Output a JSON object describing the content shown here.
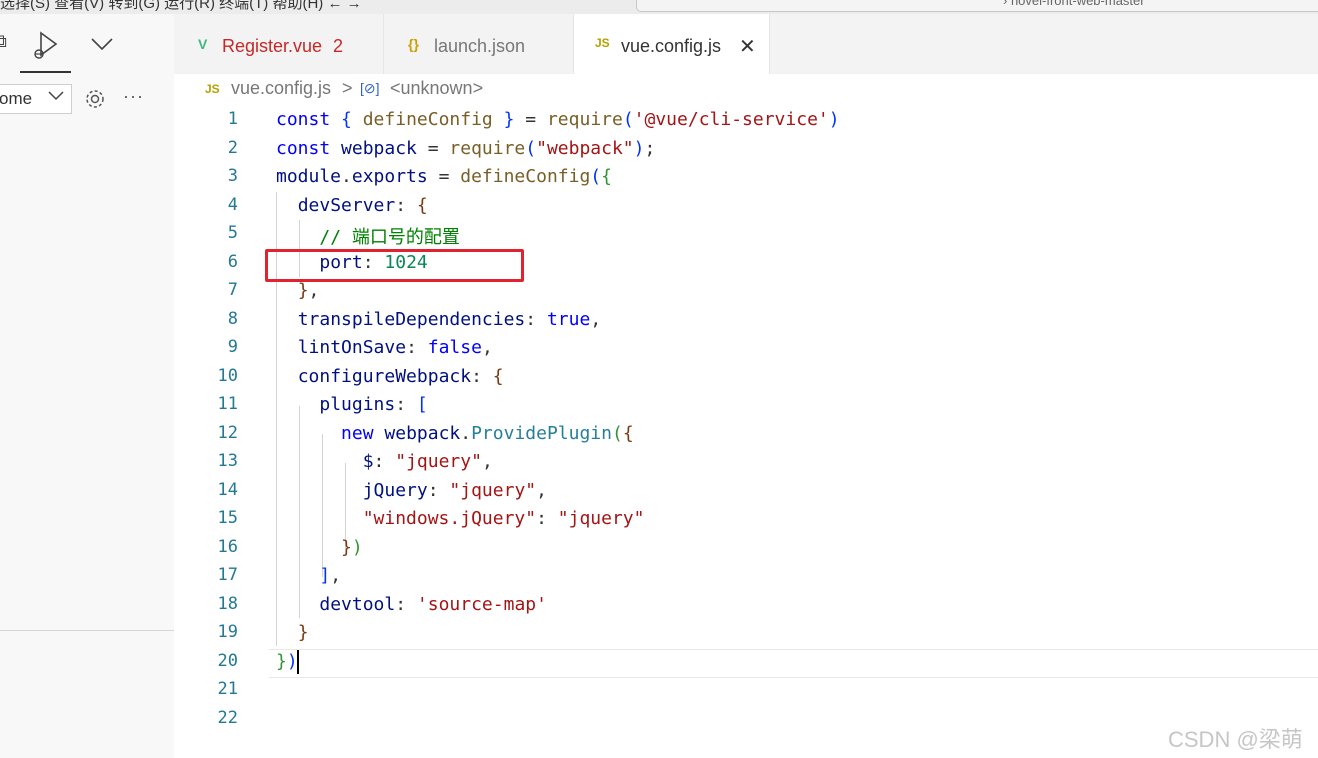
{
  "window": {
    "menu_text": "选择(S)  查看(V)  转到(G)  运行(R)  终端(T)  帮助(H)      ←  →",
    "search_text": "› novel-front-web-master"
  },
  "sidebar": {
    "select_value": "ome",
    "icons": [
      "split-icon",
      "run-debug-icon",
      "chevron-down-icon",
      "gear-icon",
      "more-icon"
    ]
  },
  "tabs": [
    {
      "label": "Register.vue",
      "badge": "2",
      "icon": "V",
      "color": "#c62828",
      "active": false
    },
    {
      "label": "launch.json",
      "icon": "{}",
      "color": "#777777",
      "active": false
    },
    {
      "label": "vue.config.js",
      "icon": "JS",
      "color": "#333333",
      "active": true
    }
  ],
  "breadcrumb": {
    "file_icon": "JS",
    "file": "vue.config.js",
    "separator": ">",
    "symbol_icon": "[⊘]",
    "symbol": "<unknown>"
  },
  "editor": {
    "line_numbers": [
      "1",
      "2",
      "3",
      "4",
      "5",
      "6",
      "7",
      "8",
      "9",
      "10",
      "11",
      "12",
      "13",
      "14",
      "15",
      "16",
      "17",
      "18",
      "19",
      "20",
      "21",
      "22"
    ],
    "lines": [
      [
        [
          "kw",
          "const "
        ],
        [
          "b1",
          "{ "
        ],
        [
          "fn",
          "defineConfig"
        ],
        [
          "b1",
          " }"
        ],
        [
          "pn",
          " = "
        ],
        [
          "fn",
          "require"
        ],
        [
          "b1",
          "("
        ],
        [
          "str",
          "'@vue/cli-service'"
        ],
        [
          "b1",
          ")"
        ]
      ],
      [
        [
          "kw",
          "const "
        ],
        [
          "var",
          "webpack"
        ],
        [
          "pn",
          " = "
        ],
        [
          "fn",
          "require"
        ],
        [
          "b1",
          "("
        ],
        [
          "str",
          "\"webpack\""
        ],
        [
          "b1",
          ")"
        ],
        [
          "pn",
          ";"
        ]
      ],
      [
        [
          "var",
          "module"
        ],
        [
          "pn",
          "."
        ],
        [
          "var",
          "exports"
        ],
        [
          "pn",
          " = "
        ],
        [
          "fn",
          "defineConfig"
        ],
        [
          "b1",
          "("
        ],
        [
          "b2",
          "{"
        ]
      ],
      [
        [
          "pn",
          "  "
        ],
        [
          "var",
          "devServer"
        ],
        [
          "pn",
          ": "
        ],
        [
          "b3",
          "{"
        ]
      ],
      [
        [
          "pn",
          "    "
        ],
        [
          "cm",
          "// 端口号的配置"
        ]
      ],
      [
        [
          "pn",
          "    "
        ],
        [
          "var",
          "port"
        ],
        [
          "pn",
          ": "
        ],
        [
          "num",
          "1024"
        ]
      ],
      [
        [
          "pn",
          "  "
        ],
        [
          "b3",
          "}"
        ],
        [
          "pn",
          ","
        ]
      ],
      [
        [
          "pn",
          "  "
        ],
        [
          "var",
          "transpileDependencies"
        ],
        [
          "pn",
          ": "
        ],
        [
          "kw",
          "true"
        ],
        [
          "pn",
          ","
        ]
      ],
      [
        [
          "pn",
          "  "
        ],
        [
          "var",
          "lintOnSave"
        ],
        [
          "pn",
          ": "
        ],
        [
          "kw",
          "false"
        ],
        [
          "pn",
          ","
        ]
      ],
      [
        [
          "pn",
          "  "
        ],
        [
          "var",
          "configureWebpack"
        ],
        [
          "pn",
          ": "
        ],
        [
          "b3",
          "{"
        ]
      ],
      [
        [
          "pn",
          "    "
        ],
        [
          "var",
          "plugins"
        ],
        [
          "pn",
          ": "
        ],
        [
          "b1",
          "["
        ]
      ],
      [
        [
          "pn",
          "      "
        ],
        [
          "kw",
          "new "
        ],
        [
          "var",
          "webpack"
        ],
        [
          "pn",
          "."
        ],
        [
          "cls",
          "ProvidePlugin"
        ],
        [
          "b2",
          "("
        ],
        [
          "b3",
          "{"
        ]
      ],
      [
        [
          "pn",
          "        "
        ],
        [
          "var",
          "$"
        ],
        [
          "pn",
          ": "
        ],
        [
          "str",
          "\"jquery\""
        ],
        [
          "pn",
          ","
        ]
      ],
      [
        [
          "pn",
          "        "
        ],
        [
          "var",
          "jQuery"
        ],
        [
          "pn",
          ": "
        ],
        [
          "str",
          "\"jquery\""
        ],
        [
          "pn",
          ","
        ]
      ],
      [
        [
          "pn",
          "        "
        ],
        [
          "str",
          "\"windows.jQuery\""
        ],
        [
          "pn",
          ": "
        ],
        [
          "str",
          "\"jquery\""
        ]
      ],
      [
        [
          "pn",
          "      "
        ],
        [
          "b3",
          "}"
        ],
        [
          "b2",
          ")"
        ]
      ],
      [
        [
          "pn",
          "    "
        ],
        [
          "b1",
          "]"
        ],
        [
          "pn",
          ","
        ]
      ],
      [
        [
          "pn",
          "    "
        ],
        [
          "var",
          "devtool"
        ],
        [
          "pn",
          ": "
        ],
        [
          "str",
          "'source-map'"
        ]
      ],
      [
        [
          "pn",
          "  "
        ],
        [
          "b3",
          "}"
        ]
      ],
      [
        [
          "b2",
          "}"
        ],
        [
          "b1",
          ")"
        ]
      ],
      [],
      []
    ]
  },
  "watermark": "CSDN @梁萌",
  "colors": {
    "highlight_box": "#e0232f",
    "line_number": "#237893",
    "keyword": "#0000ff",
    "string": "#a31515",
    "number": "#098658",
    "comment": "#008000"
  }
}
